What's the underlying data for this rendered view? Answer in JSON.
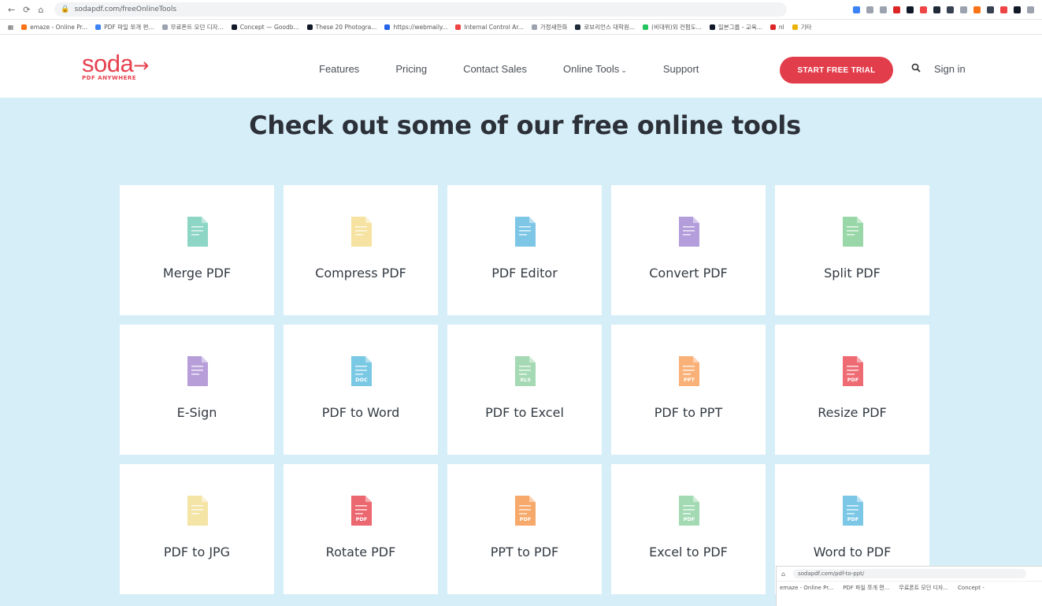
{
  "browser": {
    "url": "sodapdf.com/freeOnlineTools",
    "nav": [
      "←",
      "⟳",
      "⌂"
    ],
    "extension_colors": [
      "#3b82f6",
      "#9ca3af",
      "#9ca3af",
      "#dc2626",
      "#111827",
      "#ef4444",
      "#1f2937",
      "#374151",
      "#9ca3af",
      "#f97316",
      "#374151",
      "#ef4444",
      "#111827",
      "#9ca3af"
    ],
    "bookmarks": [
      {
        "label": "emaze - Online Pr...",
        "color": "#f97316"
      },
      {
        "label": "PDF 파일 쪼개 편...",
        "color": "#3b82f6"
      },
      {
        "label": "무료폰트 모던 디자...",
        "color": "#9ca3af"
      },
      {
        "label": "Concept — Goodb...",
        "color": "#111827"
      },
      {
        "label": "These 20 Photogra...",
        "color": "#111827"
      },
      {
        "label": "https://webmaily...",
        "color": "#2563eb"
      },
      {
        "label": "Internal Control Ar...",
        "color": "#ef4444"
      },
      {
        "label": "가정새한화",
        "color": "#9ca3af"
      },
      {
        "label": "로보리언스 대학원...",
        "color": "#1f2937"
      },
      {
        "label": "(비대위)외 컨펌도...",
        "color": "#22c55e"
      },
      {
        "label": "일본그룹 - 교육...",
        "color": "#111827"
      },
      {
        "label": "nl",
        "color": "#dc2626"
      },
      {
        "label": "기타",
        "color": "#eab308"
      }
    ]
  },
  "header": {
    "logo_word": "soda",
    "logo_sub": "PDF ANYWHERE",
    "nav": [
      {
        "label": "Features"
      },
      {
        "label": "Pricing"
      },
      {
        "label": "Contact Sales"
      },
      {
        "label": "Online Tools",
        "dropdown": true
      },
      {
        "label": "Support"
      }
    ],
    "cta": "START FREE TRIAL",
    "signin": "Sign in",
    "accent": "#e23d4b"
  },
  "main": {
    "title": "Check out some of our free online tools",
    "background": "#d6eef8",
    "tools": [
      {
        "label": "Merge PDF",
        "icon": "merge-icon",
        "color": "#8dd5c4",
        "badge": ""
      },
      {
        "label": "Compress PDF",
        "icon": "compress-icon",
        "color": "#f6e3a1",
        "badge": ""
      },
      {
        "label": "PDF Editor",
        "icon": "editor-icon",
        "color": "#7ec6e6",
        "badge": ""
      },
      {
        "label": "Convert PDF",
        "icon": "convert-icon",
        "color": "#b49ddb",
        "badge": ""
      },
      {
        "label": "Split PDF",
        "icon": "split-icon",
        "color": "#9ad7a8",
        "badge": ""
      },
      {
        "label": "E-Sign",
        "icon": "esign-icon",
        "color": "#b89ed9",
        "badge": ""
      },
      {
        "label": "PDF to Word",
        "icon": "word-doc-icon",
        "color": "#79c8e4",
        "badge": "DOC"
      },
      {
        "label": "PDF to Excel",
        "icon": "excel-icon",
        "color": "#a4d9b3",
        "badge": "XLS"
      },
      {
        "label": "PDF to PPT",
        "icon": "ppt-icon",
        "color": "#f9b178",
        "badge": "PPT"
      },
      {
        "label": "Resize PDF",
        "icon": "resize-icon",
        "color": "#ee6b73",
        "badge": "PDF"
      },
      {
        "label": "PDF to JPG",
        "icon": "jpg-icon",
        "color": "#f4e4a6",
        "badge": ""
      },
      {
        "label": "Rotate PDF",
        "icon": "rotate-icon",
        "color": "#ec6870",
        "badge": "PDF"
      },
      {
        "label": "PPT to PDF",
        "icon": "ppt-to-pdf-icon",
        "color": "#f6a96a",
        "badge": "PDF"
      },
      {
        "label": "Excel to PDF",
        "icon": "excel-to-pdf-icon",
        "color": "#a3dab4",
        "badge": "PDF"
      },
      {
        "label": "Word to PDF",
        "icon": "word-to-pdf-icon",
        "color": "#7cc7e6",
        "badge": "PDF"
      }
    ]
  },
  "overlay_window": {
    "url": "sodapdf.com/pdf-to-ppt/",
    "bookmarks": [
      "emaze - Online Pr...",
      "PDF 파일 쪼개 편...",
      "무료폰트 모던 디자...",
      "Concept -"
    ]
  }
}
